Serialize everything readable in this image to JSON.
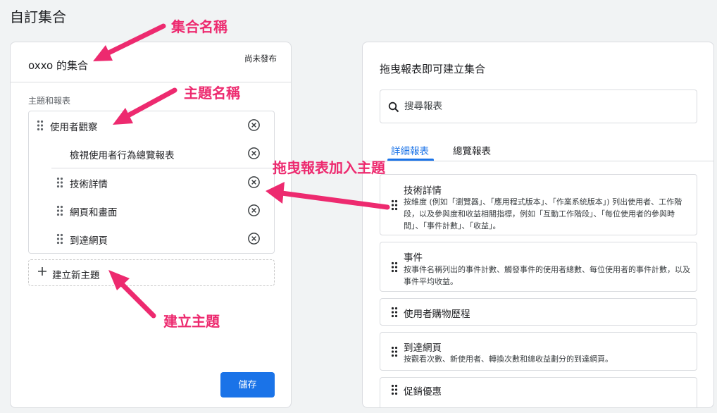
{
  "page": {
    "title": "自訂集合"
  },
  "collection": {
    "name": "oxxo 的集合",
    "status": "尚未發布",
    "section_label": "主題和報表",
    "topics": [
      {
        "label": "使用者觀察",
        "reports": [
          {
            "label": "檢視使用者行為總覽報表"
          }
        ]
      },
      {
        "label": "技術詳情"
      },
      {
        "label": "網頁和畫面"
      },
      {
        "label": "到達網頁"
      }
    ],
    "new_topic_label": "建立新主題",
    "save_label": "儲存"
  },
  "library": {
    "title": "拖曳報表即可建立集合",
    "search_placeholder": "搜尋報表",
    "tabs": [
      {
        "label": "詳細報表",
        "active": true
      },
      {
        "label": "總覽報表",
        "active": false
      }
    ],
    "reports": [
      {
        "title": "技術詳情",
        "desc": "按維度 (例如「瀏覽器」、「應用程式版本」、「作業系統版本」) 列出使用者、工作階段，以及參與度和收益相關指標，例如「互動工作階段」、「每位使用者的參與時間」、「事件計數」、「收益」。"
      },
      {
        "title": "事件",
        "desc": "按事件名稱列出的事件計數、觸發事件的使用者總數、每位使用者的事件計數，以及事件平均收益。"
      },
      {
        "title": "使用者購物歷程",
        "desc": ""
      },
      {
        "title": "到達網頁",
        "desc": "按觀看次數、新使用者、轉換次數和總收益劃分的到達網頁。"
      },
      {
        "title": "促銷優惠",
        "desc": ""
      }
    ]
  },
  "annotations": {
    "collection_name": "集合名稱",
    "topic_name": "主題名稱",
    "drag_to_topic": "拖曳報表加入主題",
    "create_topic": "建立主題"
  },
  "colors": {
    "accent": "#1a73e8",
    "annotation": "#ed2a6f"
  }
}
